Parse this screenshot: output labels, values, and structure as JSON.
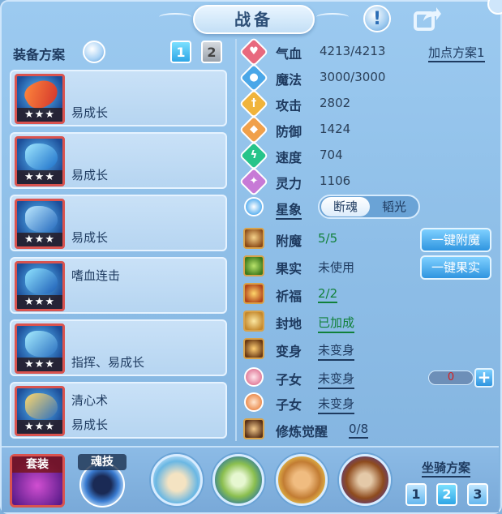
{
  "header": {
    "title": "战备"
  },
  "loadout": {
    "label": "装备方案",
    "tabs": [
      "1",
      "2"
    ],
    "active_tab": "1",
    "items": [
      {
        "line1": "",
        "line2": "易成长",
        "stars": "★★★"
      },
      {
        "line1": "",
        "line2": "易成长",
        "stars": "★★★"
      },
      {
        "line1": "",
        "line2": "易成长",
        "stars": "★★★"
      },
      {
        "line1": "嗜血连击",
        "line2": "",
        "stars": "★★★"
      },
      {
        "line1": "",
        "line2": "指挥、易成长",
        "stars": "★★★"
      },
      {
        "line1": "清心术",
        "line2": "易成长",
        "stars": "★★★"
      }
    ]
  },
  "stats": {
    "add_point_label": "加点方案1",
    "rows": [
      {
        "label": "气血",
        "value": "4213/4213",
        "icon": "heart-icon",
        "color": "#e8697e"
      },
      {
        "label": "魔法",
        "value": "3000/3000",
        "icon": "mana-icon",
        "color": "#4aa7e8"
      },
      {
        "label": "攻击",
        "value": "2802",
        "icon": "sword-icon",
        "color": "#f0b43c"
      },
      {
        "label": "防御",
        "value": "1424",
        "icon": "shield-icon",
        "color": "#f0a04a"
      },
      {
        "label": "速度",
        "value": "704",
        "icon": "lightning-icon",
        "color": "#27c48a"
      },
      {
        "label": "灵力",
        "value": "1106",
        "icon": "spirit-icon",
        "color": "#c77ad6"
      }
    ],
    "star_label": "星象",
    "star_options": [
      "断魂",
      "韬光"
    ]
  },
  "features": {
    "rows": [
      {
        "label": "附魔",
        "value": "5/5",
        "green": true
      },
      {
        "label": "果实",
        "value": "未使用",
        "green": false
      },
      {
        "label": "祈福",
        "value": "2/2",
        "green": true
      },
      {
        "label": "封地",
        "value": "已加成",
        "green": true
      },
      {
        "label": "变身",
        "value": "未变身",
        "green": false
      },
      {
        "label": "子女",
        "value": "未变身",
        "green": false
      },
      {
        "label": "子女",
        "value": "未变身",
        "green": false
      },
      {
        "label": "修炼觉醒",
        "value": "0/8",
        "green": false
      }
    ],
    "enchant_button": "一键附魔",
    "fruit_button": "一键果实",
    "child_counter": "0",
    "plus": "+"
  },
  "bottom": {
    "set_label": "套装",
    "soul_label": "魂技",
    "mount_label": "坐骑方案",
    "mount_tabs": [
      "1",
      "2",
      "3"
    ],
    "active_mount": "2"
  }
}
